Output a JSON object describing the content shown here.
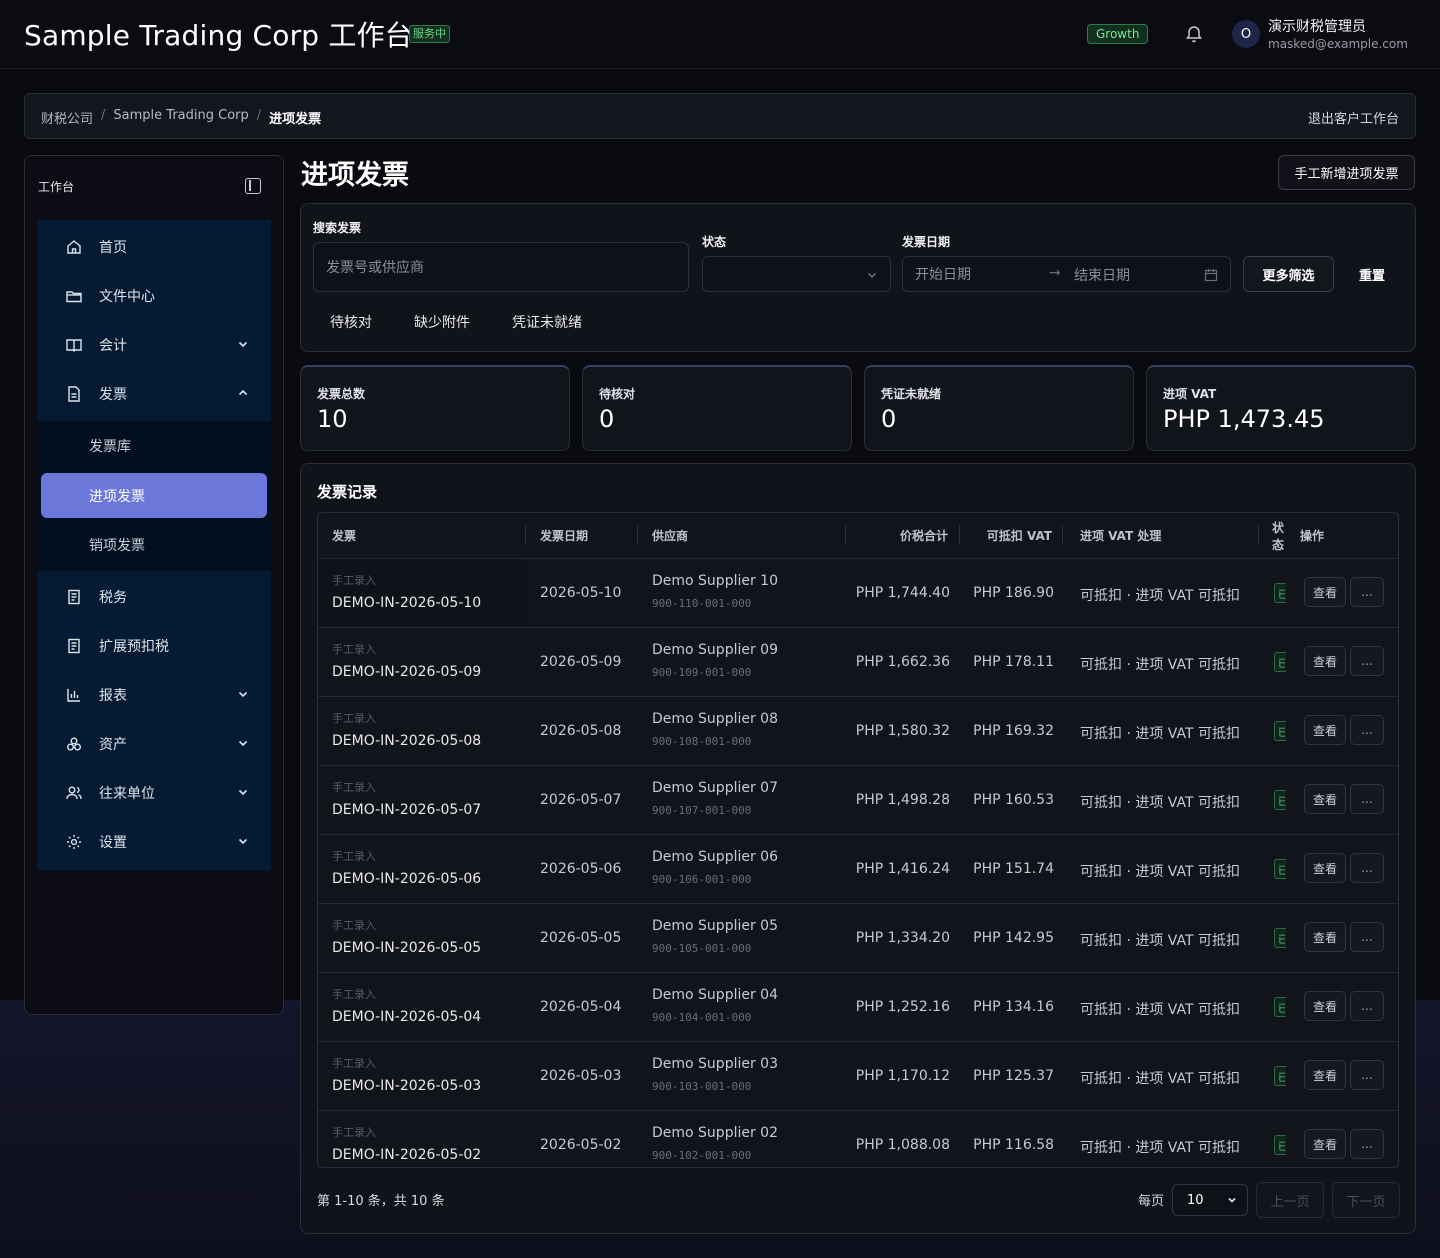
{
  "header": {
    "title": "Sample Trading Corp 工作台",
    "status_badge": "服务中",
    "plan": "Growth",
    "user": {
      "initial": "O",
      "name": "演示财税管理员",
      "email": "masked@example.com"
    }
  },
  "breadcrumb": {
    "items": [
      "财税公司",
      "Sample Trading Corp",
      "进项发票"
    ],
    "separator": "/",
    "exit_label": "退出客户工作台"
  },
  "sidebar": {
    "title": "工作台",
    "items": [
      {
        "label": "首页",
        "icon": "home-icon"
      },
      {
        "label": "文件中心",
        "icon": "folder-icon"
      },
      {
        "label": "会计",
        "icon": "book-icon"
      },
      {
        "label": "发票",
        "icon": "document-icon"
      },
      {
        "label": "税务",
        "icon": "document-icon"
      },
      {
        "label": "扩展预扣税",
        "icon": "document-icon"
      },
      {
        "label": "报表",
        "icon": "bar-chart-icon"
      },
      {
        "label": "资产",
        "icon": "assets-icon"
      },
      {
        "label": "往来单位",
        "icon": "users-icon"
      },
      {
        "label": "设置",
        "icon": "gear-icon"
      }
    ],
    "invoice_sub": [
      "发票库",
      "进项发票",
      "销项发票"
    ],
    "active_sub": "进项发票",
    "accent": "#6c78d9"
  },
  "page": {
    "title": "进项发票",
    "add_button": "手工新增进项发票"
  },
  "filters": {
    "search_label": "搜索发票",
    "search_placeholder": "发票号或供应商",
    "status_label": "状态",
    "date_label": "发票日期",
    "start_placeholder": "开始日期",
    "end_placeholder": "结束日期",
    "more_filters": "更多筛选",
    "reset": "重置",
    "chips": [
      "待核对",
      "缺少附件",
      "凭证未就绪"
    ]
  },
  "stats": [
    {
      "label": "发票总数",
      "value": "10"
    },
    {
      "label": "待核对",
      "value": "0"
    },
    {
      "label": "凭证未就绪",
      "value": "0"
    },
    {
      "label": "进项 VAT",
      "value": "PHP 1,473.45"
    }
  ],
  "records": {
    "title": "发票记录",
    "columns": [
      "发票",
      "发票日期",
      "供应商",
      "价税合计",
      "可抵扣 VAT",
      "进项 VAT 处理",
      "状态",
      "操作"
    ],
    "rows": [
      {
        "source": "手工录入",
        "invoice": "DEMO-IN-2026-05-10",
        "date": "2026-05-10",
        "supplier": "Demo Supplier 10",
        "tin": "900-110-001-000",
        "total": "PHP 1,744.40",
        "vat": "PHP 186.90",
        "treatment": "可抵扣 · 进项 VAT 可抵扣",
        "status": "已",
        "view": "查看",
        "more": "..."
      },
      {
        "source": "手工录入",
        "invoice": "DEMO-IN-2026-05-09",
        "date": "2026-05-09",
        "supplier": "Demo Supplier 09",
        "tin": "900-109-001-000",
        "total": "PHP 1,662.36",
        "vat": "PHP 178.11",
        "treatment": "可抵扣 · 进项 VAT 可抵扣",
        "status": "已",
        "view": "查看",
        "more": "..."
      },
      {
        "source": "手工录入",
        "invoice": "DEMO-IN-2026-05-08",
        "date": "2026-05-08",
        "supplier": "Demo Supplier 08",
        "tin": "900-108-001-000",
        "total": "PHP 1,580.32",
        "vat": "PHP 169.32",
        "treatment": "可抵扣 · 进项 VAT 可抵扣",
        "status": "已",
        "view": "查看",
        "more": "..."
      },
      {
        "source": "手工录入",
        "invoice": "DEMO-IN-2026-05-07",
        "date": "2026-05-07",
        "supplier": "Demo Supplier 07",
        "tin": "900-107-001-000",
        "total": "PHP 1,498.28",
        "vat": "PHP 160.53",
        "treatment": "可抵扣 · 进项 VAT 可抵扣",
        "status": "已",
        "view": "查看",
        "more": "..."
      },
      {
        "source": "手工录入",
        "invoice": "DEMO-IN-2026-05-06",
        "date": "2026-05-06",
        "supplier": "Demo Supplier 06",
        "tin": "900-106-001-000",
        "total": "PHP 1,416.24",
        "vat": "PHP 151.74",
        "treatment": "可抵扣 · 进项 VAT 可抵扣",
        "status": "已",
        "view": "查看",
        "more": "..."
      },
      {
        "source": "手工录入",
        "invoice": "DEMO-IN-2026-05-05",
        "date": "2026-05-05",
        "supplier": "Demo Supplier 05",
        "tin": "900-105-001-000",
        "total": "PHP 1,334.20",
        "vat": "PHP 142.95",
        "treatment": "可抵扣 · 进项 VAT 可抵扣",
        "status": "已",
        "view": "查看",
        "more": "..."
      },
      {
        "source": "手工录入",
        "invoice": "DEMO-IN-2026-05-04",
        "date": "2026-05-04",
        "supplier": "Demo Supplier 04",
        "tin": "900-104-001-000",
        "total": "PHP 1,252.16",
        "vat": "PHP 134.16",
        "treatment": "可抵扣 · 进项 VAT 可抵扣",
        "status": "已",
        "view": "查看",
        "more": "..."
      },
      {
        "source": "手工录入",
        "invoice": "DEMO-IN-2026-05-03",
        "date": "2026-05-03",
        "supplier": "Demo Supplier 03",
        "tin": "900-103-001-000",
        "total": "PHP 1,170.12",
        "vat": "PHP 125.37",
        "treatment": "可抵扣 · 进项 VAT 可抵扣",
        "status": "已",
        "view": "查看",
        "more": "..."
      },
      {
        "source": "手工录入",
        "invoice": "DEMO-IN-2026-05-02",
        "date": "2026-05-02",
        "supplier": "Demo Supplier 02",
        "tin": "900-102-001-000",
        "total": "PHP 1,088.08",
        "vat": "PHP 116.58",
        "treatment": "可抵扣 · 进项 VAT 可抵扣",
        "status": "已",
        "view": "查看",
        "more": "..."
      }
    ]
  },
  "pagination": {
    "info": "第 1-10 条，共 10 条",
    "per_page_label": "每页",
    "per_page_value": "10",
    "prev": "上一页",
    "next": "下一页"
  }
}
